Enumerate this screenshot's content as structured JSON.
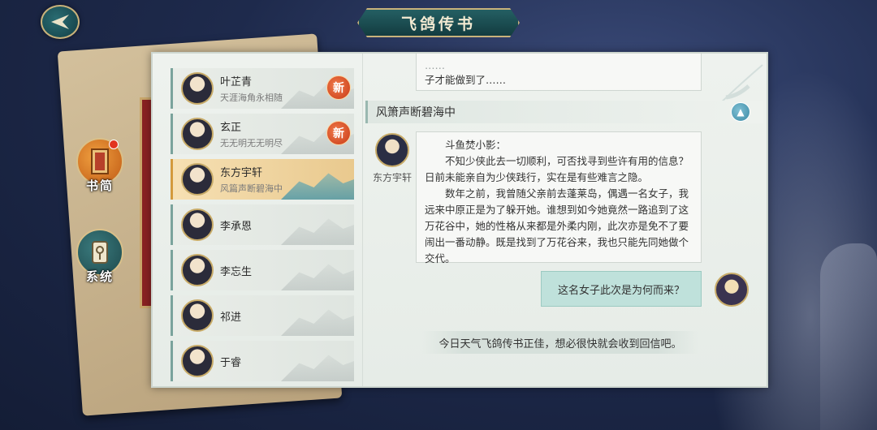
{
  "header": {
    "title": "飞鸽传书"
  },
  "sidebar": {
    "tabs": [
      {
        "label": "书简",
        "icon": "scroll-icon",
        "active": true
      },
      {
        "label": "系统",
        "icon": "lantern-icon",
        "active": false
      }
    ]
  },
  "contacts": [
    {
      "name": "叶芷青",
      "status": "天涯海角永相随",
      "badge": "新",
      "selected": false
    },
    {
      "name": "玄正",
      "status": "无无明无无明尽",
      "badge": "新",
      "selected": false
    },
    {
      "name": "东方宇轩",
      "status": "风篇声断碧海中",
      "badge": "",
      "selected": true
    },
    {
      "name": "李承恩",
      "status": "",
      "badge": "",
      "selected": false
    },
    {
      "name": "李忘生",
      "status": "",
      "badge": "",
      "selected": false
    },
    {
      "name": "祁进",
      "status": "",
      "badge": "",
      "selected": false
    },
    {
      "name": "于睿",
      "status": "",
      "badge": "",
      "selected": false
    }
  ],
  "chat": {
    "prev_bubble_partial": "子才能做到了……",
    "thread_title": "风箫声断碧海中",
    "sender_name": "东方宇轩",
    "incoming": {
      "greeting": "斗鱼焚小影：",
      "para1": "不知少侠此去一切顺利，可否找寻到些许有用的信息？日前未能亲自为少侠践行，实在是有些难言之隐。",
      "para2": "数年之前，我曾随父亲前去蓬莱岛，偶遇一名女子，我远来中原正是为了躲开她。谁想到如今她竟然一路追到了这万花谷中，她的性格从来都是外柔内刚，此次亦是免不了要闹出一番动静。既是找到了万花谷来，我也只能先同她做个交代。"
    },
    "outgoing": "这名女子此次是为何而来？",
    "system_note": "今日天气飞鸽传书正佳，想必很快就会收到回信吧。"
  },
  "colors": {
    "accent": "#245f63",
    "gold": "#c8b27b",
    "badge_red": "#d2451c",
    "selected_row": "#f0d49e"
  }
}
